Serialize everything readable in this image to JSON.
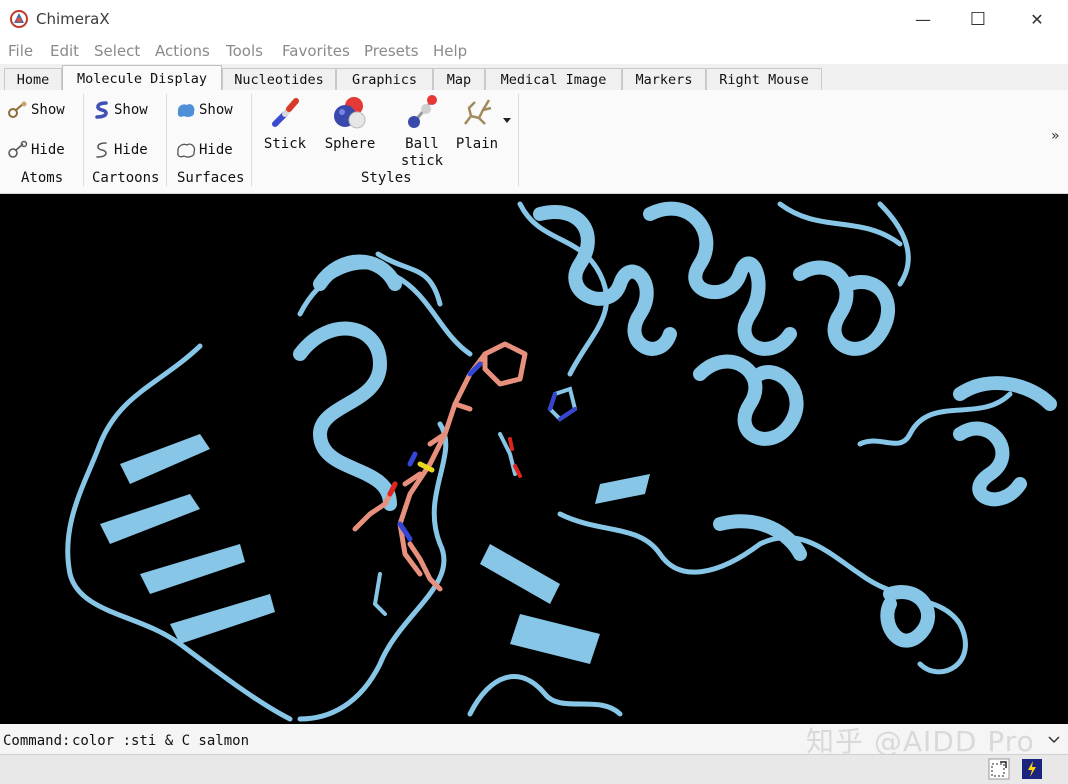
{
  "window": {
    "title": "ChimeraX",
    "minimize_glyph": "—",
    "maximize_glyph": "☐",
    "close_glyph": "✕"
  },
  "menu": [
    "File",
    "Edit",
    "Select",
    "Actions",
    "Tools",
    "Favorites",
    "Presets",
    "Help"
  ],
  "tabs": [
    "Home",
    "Molecule Display",
    "Nucleotides",
    "Graphics",
    "Map",
    "Medical Image",
    "Markers",
    "Right Mouse"
  ],
  "active_tab": "Molecule Display",
  "toolbar": {
    "atoms": {
      "show": "Show",
      "hide": "Hide",
      "label": "Atoms"
    },
    "cartoons": {
      "show": "Show",
      "hide": "Hide",
      "label": "Cartoons"
    },
    "surfaces": {
      "show": "Show",
      "hide": "Hide",
      "label": "Surfaces"
    },
    "styles": {
      "label": "Styles",
      "stick": "Stick",
      "sphere": "Sphere",
      "ballstick_1": "Ball",
      "ballstick_2": "stick",
      "plain": "Plain"
    },
    "more": "»"
  },
  "command": {
    "label": "Command:",
    "value": "color :sti & C salmon"
  },
  "watermark": "知乎 @AIDD Pro",
  "colors": {
    "protein": "#87c6e6",
    "ligand_carbon": "#e8907e",
    "nitrogen": "#3546d6",
    "oxygen": "#e0241c",
    "sulfur": "#e8d621",
    "background": "#000000"
  }
}
